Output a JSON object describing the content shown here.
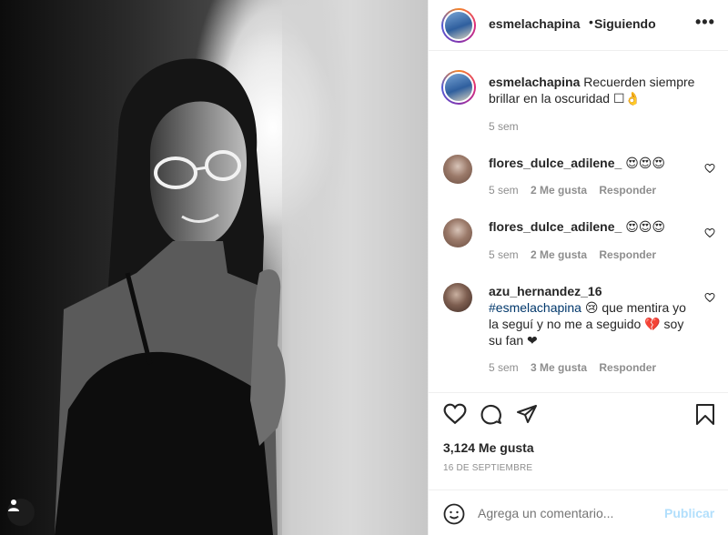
{
  "header": {
    "username": "esmelachapina",
    "separator": "•",
    "follow_label": "Siguiendo",
    "more_glyph": "•••"
  },
  "caption": {
    "username": "esmelachapina",
    "text": "Recuerden siempre brillar en la oscuridad ☐👌",
    "time": "5 sem"
  },
  "comments": [
    {
      "username": "flores_dulce_adilene_",
      "text": "😍😍😍",
      "time": "5 sem",
      "likes": "2 Me gusta",
      "reply": "Responder"
    },
    {
      "username": "flores_dulce_adilene_",
      "text": "😍😍😍",
      "time": "5 sem",
      "likes": "2 Me gusta",
      "reply": "Responder"
    },
    {
      "username": "azu_hernandez_16",
      "mention": "#esmelachapina",
      "text": "😢 que mentira yo la seguí y no me a seguido 💔 soy su fan ❤",
      "time": "5 sem",
      "likes": "3 Me gusta",
      "reply": "Responder"
    }
  ],
  "likes_count": "3,124 Me gusta",
  "date": "16 DE SEPTIEMBRE",
  "comment_box": {
    "placeholder": "Agrega un comentario...",
    "publish_label": "Publicar"
  },
  "icons": {
    "user_tag": "user-tag-icon",
    "more": "more-options-icon",
    "like": "heart-icon",
    "comment": "comment-icon",
    "share": "paper-plane-icon",
    "save": "bookmark-icon",
    "emoji": "emoji-icon"
  },
  "colors": {
    "link": "#00376b",
    "meta": "#8e8e8e",
    "publish_disabled": "#b2dffc",
    "divider": "#efefef"
  }
}
